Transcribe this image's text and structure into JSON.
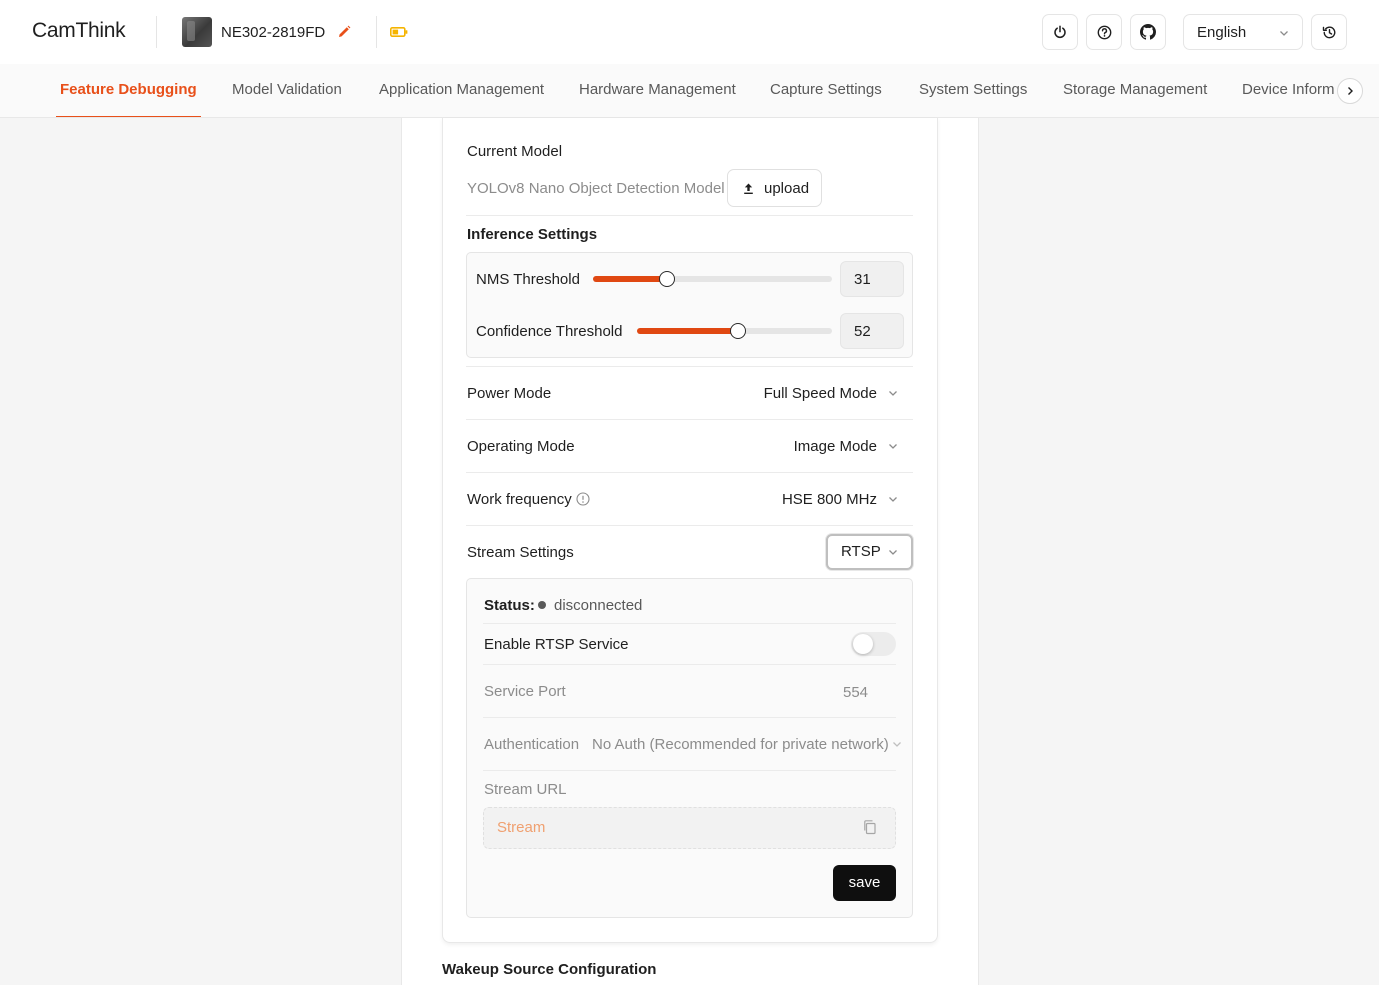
{
  "header": {
    "logo": "CamThink",
    "device_name": "NE302-2819FD",
    "language": "English",
    "icons": [
      "power-icon",
      "help-icon",
      "github-icon",
      "history-icon",
      "edit-icon",
      "battery-icon"
    ]
  },
  "tabs": [
    {
      "label": "Feature Debugging",
      "active": true
    },
    {
      "label": "Model Validation"
    },
    {
      "label": "Application Management"
    },
    {
      "label": "Hardware Management"
    },
    {
      "label": "Capture Settings"
    },
    {
      "label": "System Settings"
    },
    {
      "label": "Storage Management"
    },
    {
      "label": "Device Inform"
    }
  ],
  "model": {
    "current_label": "Current Model",
    "name": "YOLOv8 Nano Object Detection Model",
    "upload_label": "upload"
  },
  "inference": {
    "title": "Inference Settings",
    "nms_label": "NMS Threshold",
    "nms_value": "31",
    "confidence_label": "Confidence Threshold",
    "confidence_value": "52"
  },
  "settings": {
    "power_mode_label": "Power Mode",
    "power_mode_value": "Full Speed Mode",
    "operating_mode_label": "Operating Mode",
    "operating_mode_value": "Image Mode",
    "work_frequency_label": "Work frequency",
    "work_frequency_value": "HSE 800 MHz",
    "stream_settings_label": "Stream Settings",
    "stream_settings_value": "RTSP"
  },
  "rtsp": {
    "status_label": "Status:",
    "status_value": "disconnected",
    "enable_label": "Enable RTSP Service",
    "enabled": false,
    "port_label": "Service Port",
    "port_value": "554",
    "auth_label": "Authentication",
    "auth_value": "No Auth (Recommended for private network)",
    "url_label": "Stream URL",
    "url_placeholder": "Stream",
    "save_label": "save"
  },
  "wakeup": {
    "title": "Wakeup Source Configuration"
  },
  "colors": {
    "accent": "#e8501a",
    "slider_fill": "#e04812",
    "primary_button": "#0f0f0f"
  }
}
